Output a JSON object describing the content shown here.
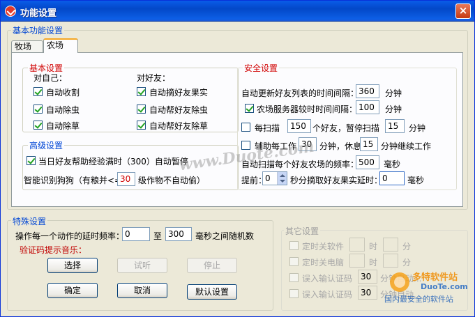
{
  "window": {
    "title": "功能设置",
    "close": "×"
  },
  "basic": {
    "legend": "基本功能设置",
    "tabs": [
      "牧场",
      "农场"
    ],
    "basic_settings": {
      "legend": "基本设置",
      "self_label": "对自己：",
      "friend_label": "对好友：",
      "self_items": [
        {
          "label": "自动收割",
          "checked": true
        },
        {
          "label": "自动除虫",
          "checked": true
        },
        {
          "label": "自动除草",
          "checked": true
        }
      ],
      "friend_items": [
        {
          "label": "自动摘好友果实",
          "checked": true
        },
        {
          "label": "自动帮好友除虫",
          "checked": true
        },
        {
          "label": "自动帮好友除草",
          "checked": true
        }
      ]
    },
    "advanced": {
      "legend": "高级设置",
      "pause_label": "当日好友帮助经验满时（300）自动暂停",
      "pause_checked": true,
      "dog_prefix": "智能识别狗狗（有粮并<=",
      "dog_value": "30",
      "dog_suffix": "级作物不自动偷）"
    },
    "security": {
      "legend": "安全设置",
      "refresh_label": "自动更新好友列表的时间间隔：",
      "refresh_value": "360",
      "refresh_unit": "分钟",
      "sync_label": "农场服务器较时时间间隔：",
      "sync_value": "100",
      "sync_unit": "分钟",
      "sync_checked": true,
      "scan_label": "每扫描",
      "scan_value": "150",
      "scan_mid": "个好友，暂停扫描",
      "scan_pause": "15",
      "scan_unit": "分钟",
      "scan_checked": false,
      "work_label": "辅助每工作",
      "work_value": "30",
      "work_mid": "分钟，休息",
      "work_rest": "15",
      "work_suffix": "分钟继续工作",
      "work_checked": false,
      "freq_label": "自动扫描每个好友农场的频率：",
      "freq_value": "500",
      "freq_unit": "毫秒",
      "advance_prefix": "提前：",
      "advance_value": "0",
      "advance_mid": "秒分摘取好友果实延时：",
      "advance_delay": "0",
      "advance_unit": "毫秒"
    }
  },
  "special": {
    "legend": "特殊设置",
    "delay_label": "操作每一个动作的延时频率：",
    "delay_min": "0",
    "delay_to": "至",
    "delay_max": "300",
    "delay_suffix": "毫秒之间随机数",
    "captcha_label": "验证码提示音乐：",
    "buttons": {
      "choose": "选择",
      "listen": "试听",
      "stop": "停止",
      "ok": "确定",
      "cancel": "取消",
      "default": "默认设置"
    }
  },
  "other": {
    "legend": "其它设置",
    "rows": [
      {
        "label": "定时关软件",
        "v1": "",
        "u1": "时",
        "v2": "",
        "u2": "分"
      },
      {
        "label": "定时关电脑",
        "v1": "",
        "u1": "时",
        "v2": "",
        "u2": "分"
      },
      {
        "label": "误入输认证码",
        "v1": "30",
        "u1": "分钟自动..."
      },
      {
        "label": "误入输认证码",
        "v1": "30",
        "u1": "分钟自动..."
      }
    ]
  },
  "watermark": "www.Duote.com",
  "site_logo": {
    "brand": "多特软件站",
    "domain": "DuoTe.com",
    "slogan": "国内最安全的软件站"
  }
}
